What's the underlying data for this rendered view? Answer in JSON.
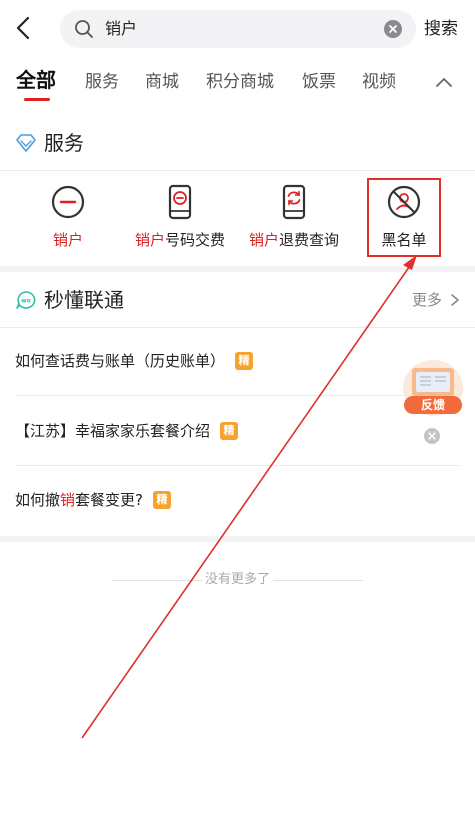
{
  "search": {
    "query": "销户",
    "button_label": "搜索"
  },
  "tabs": [
    {
      "label": "全部",
      "active": true
    },
    {
      "label": "服务"
    },
    {
      "label": "商城"
    },
    {
      "label": "积分商城"
    },
    {
      "label": "饭票"
    },
    {
      "label": "视频"
    }
  ],
  "services_section": {
    "title": "服务",
    "items": [
      {
        "highlight": "销户",
        "rest": "",
        "icon": "minus-circle-icon"
      },
      {
        "highlight": "销户",
        "rest": "号码交费",
        "icon": "phone-minus-icon"
      },
      {
        "highlight": "销户",
        "rest": "退费查询",
        "icon": "phone-refund-icon"
      },
      {
        "highlight": "",
        "rest": "黑名单",
        "icon": "blocked-user-icon"
      }
    ]
  },
  "knowledge_section": {
    "title": "秒懂联通",
    "more_label": "更多",
    "articles": [
      {
        "before": "如何查话费与账单（历史账单）",
        "hl": "",
        "after": "",
        "badge": "精"
      },
      {
        "before": "【江苏】幸福家家乐套餐介绍",
        "hl": "",
        "after": "",
        "badge": "精"
      },
      {
        "before": "如何撤",
        "hl": "销",
        "after": "套餐变更?",
        "badge": "精"
      }
    ]
  },
  "feedback": {
    "label": "反馈"
  },
  "footer": {
    "no_more": "没有更多了"
  },
  "colors": {
    "accent": "#e02020",
    "badge": "#f6a22c",
    "annotation": "#e0302a"
  }
}
